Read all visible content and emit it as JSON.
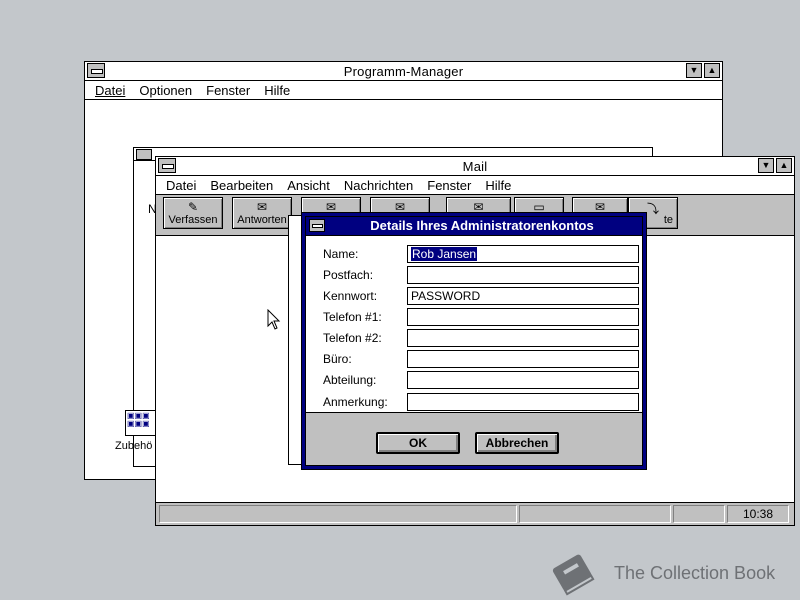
{
  "program_manager": {
    "title": "Programm-Manager",
    "menu": [
      "Datei",
      "Optionen",
      "Fenster",
      "Hilfe"
    ],
    "group_label": "Zubehö",
    "partial_letter": "N"
  },
  "mail": {
    "title": "Mail",
    "menu": [
      "Datei",
      "Bearbeiten",
      "Ansicht",
      "Nachrichten",
      "Fenster",
      "Hilfe"
    ],
    "toolbar": {
      "compose": "Verfassen",
      "reply": "Antworten",
      "partial_right": "te"
    },
    "status_time": "10:38"
  },
  "dialog": {
    "title": "Details Ihres Administratorenkontos",
    "fields": [
      {
        "label": "Name:",
        "value": "Rob Jansen"
      },
      {
        "label": "Postfach:",
        "value": ""
      },
      {
        "label": "Kennwort:",
        "value": "PASSWORD"
      },
      {
        "label": "Telefon #1:",
        "value": ""
      },
      {
        "label": "Telefon #2:",
        "value": ""
      },
      {
        "label": "Büro:",
        "value": ""
      },
      {
        "label": "Abteilung:",
        "value": ""
      },
      {
        "label": "Anmerkung:",
        "value": ""
      }
    ],
    "ok": "OK",
    "cancel": "Abbrechen"
  },
  "watermark": "The Collection Book",
  "colors": {
    "desktop": "#c3c7cb",
    "dialog_frame": "#000080",
    "selection": "#000080"
  }
}
